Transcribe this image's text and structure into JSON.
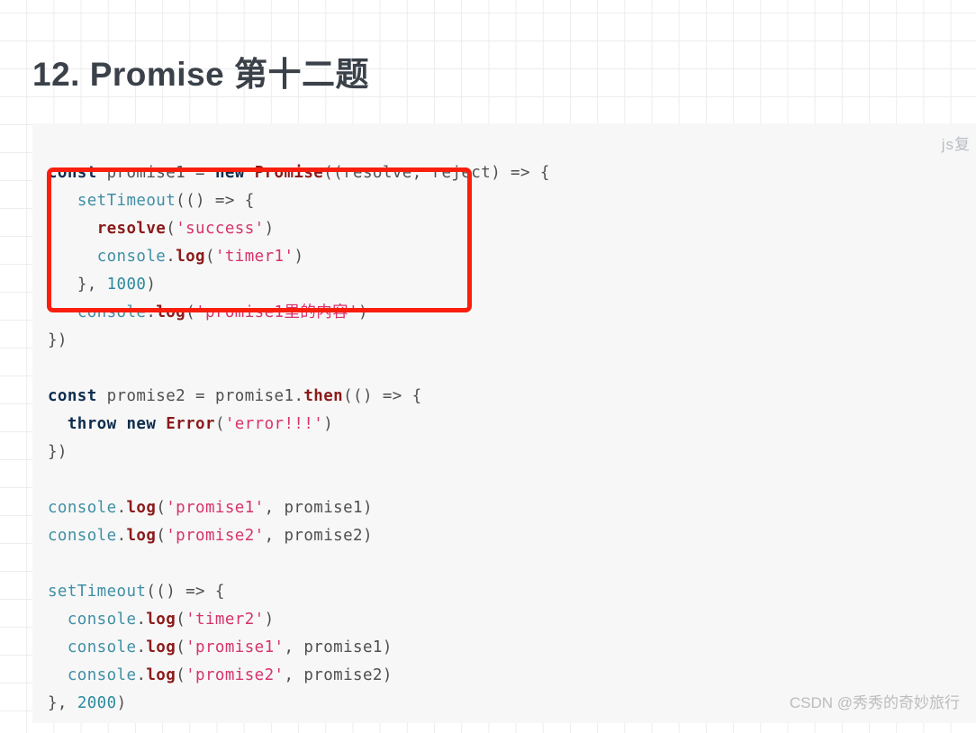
{
  "page": {
    "title": "12. Promise 第十二题",
    "background_grid": true,
    "grid_color": "#ededed"
  },
  "code_card": {
    "language_tag": "js复",
    "background": "#f7f7f7",
    "lines": [
      "const promise1 = new Promise((resolve, reject) => {",
      "   setTimeout(() => {",
      "     resolve('success')",
      "     console.log('timer1')",
      "   }, 1000)",
      "   console.log('promise1里的内容')",
      "})",
      "",
      "const promise2 = promise1.then(() => {",
      "  throw new Error('error!!!')",
      "})",
      "",
      "console.log('promise1', promise1)",
      "console.log('promise2', promise2)",
      "",
      "setTimeout(() => {",
      "  console.log('timer2')",
      "  console.log('promise1', promise1)",
      "  console.log('promise2', promise2)",
      "}, 2000)"
    ],
    "tokens": {
      "keyword_const": "const",
      "keyword_new": "new",
      "keyword_throw": "throw",
      "class_promise": "Promise",
      "class_error": "Error",
      "method_then": "then",
      "method_log": "log",
      "method_resolve": "resolve",
      "object_console": "console",
      "global_setTimeout": "setTimeout",
      "var_promise1": "promise1",
      "var_promise2": "promise2",
      "param_resolve": "resolve",
      "param_reject": "reject",
      "string_success": "'success'",
      "string_timer1": "'timer1'",
      "string_timer2": "'timer2'",
      "string_promise1": "'promise1'",
      "string_promise2": "'promise2'",
      "string_error": "'error!!!'",
      "string_cn": "'promise1里的内容'",
      "number_1000": "1000",
      "number_2000": "2000"
    },
    "colors": {
      "keyword": "#0d2c4d",
      "class": "#8b1a1a",
      "function": "#8b1a1a",
      "object": "#3f8fa5",
      "string": "#d6336c",
      "number": "#2b8a9e",
      "identifier": "#4f4f4f",
      "text": "#333333"
    }
  },
  "annotation": {
    "highlight_box_color": "#fa1e0e",
    "highlight_box_label": "red-highlight-rectangle"
  },
  "watermark": {
    "text": "CSDN @秀秀的奇妙旅行",
    "color": "#bcbcbc"
  }
}
